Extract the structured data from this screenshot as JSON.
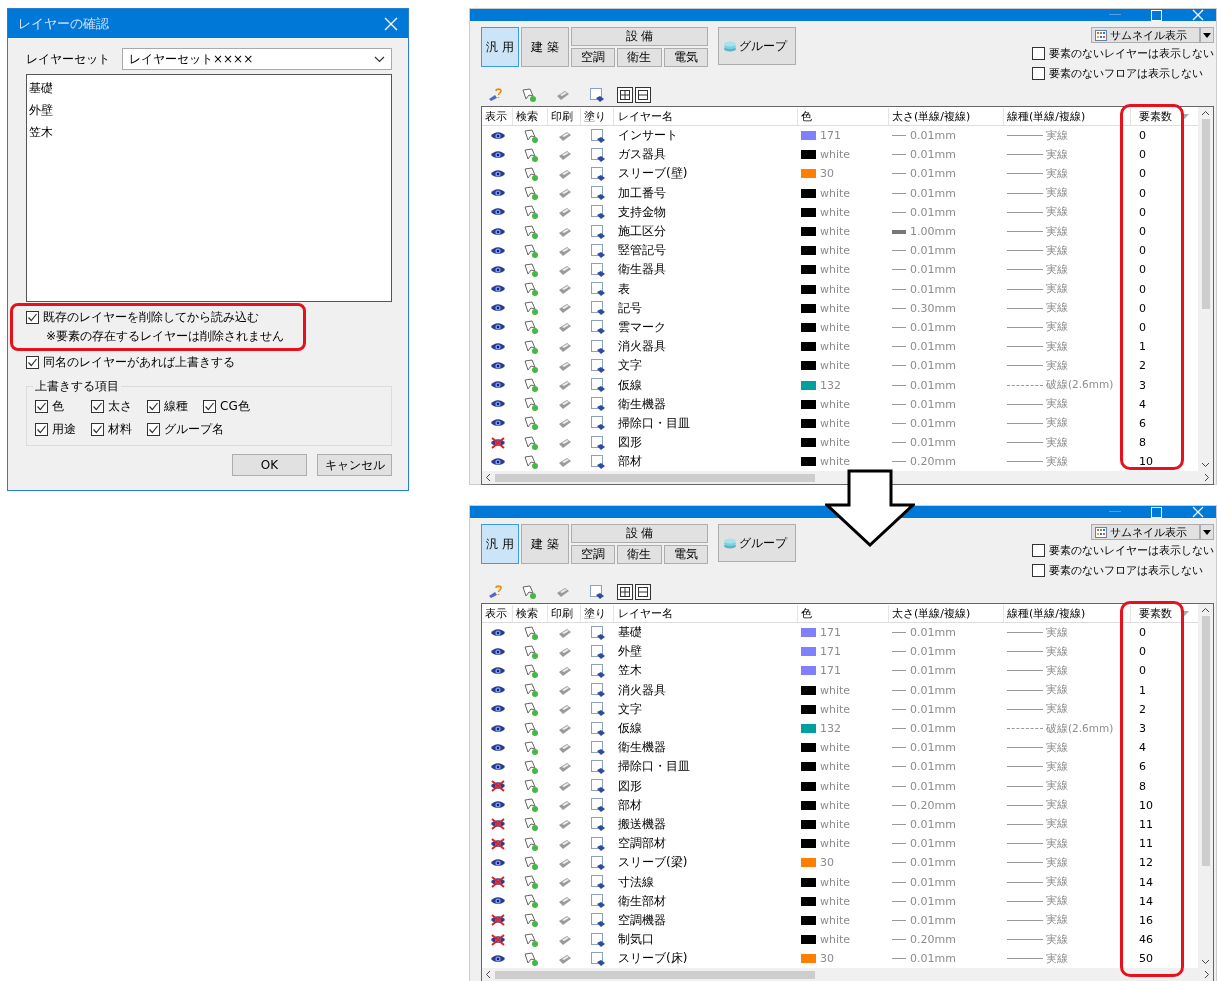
{
  "dialog": {
    "title": "レイヤーの確認",
    "layer_set": {
      "label": "レイヤーセット",
      "value": "レイヤーセット××××"
    },
    "layers": [
      "基礎",
      "外壁",
      "笠木"
    ],
    "options": [
      {
        "label": "既存のレイヤーを削除してから読み込む",
        "note": "※要素の存在するレイヤーは削除されません",
        "checked": true,
        "highlighted": true
      },
      {
        "label": "同名のレイヤーがあれば上書きする",
        "checked": true,
        "highlighted": false
      }
    ],
    "override_group": {
      "title": "上書きする項目",
      "items": [
        {
          "label": "色",
          "checked": true
        },
        {
          "label": "太さ",
          "checked": true
        },
        {
          "label": "線種",
          "checked": true
        },
        {
          "label": "CG色",
          "checked": true
        },
        {
          "label": "用途",
          "checked": true
        },
        {
          "label": "材料",
          "checked": true
        },
        {
          "label": "グループ名",
          "checked": true
        }
      ]
    },
    "buttons": [
      "OK",
      "キャンセル"
    ]
  },
  "windows": [
    {
      "tabs": [
        {
          "label": "汎 用",
          "selected": true
        },
        {
          "label": "建 築",
          "selected": false
        }
      ],
      "equipment": {
        "label": "設 備",
        "tabs": [
          {
            "label": "空調",
            "selected": false
          },
          {
            "label": "衛生",
            "selected": false
          },
          {
            "label": "電気",
            "selected": false
          }
        ]
      },
      "group_button": "グループ",
      "view_select": "サムネイル表示",
      "filters": [
        {
          "label": "要素のないレイヤーは表示しない",
          "checked": false
        },
        {
          "label": "要素のないフロアは表示しない",
          "checked": false
        }
      ],
      "columns": [
        "表示",
        "検索",
        "印刷",
        "塗り",
        "レイヤー名",
        "色",
        "太さ(単線/複線)",
        "線種(単線/複線)",
        "要素数"
      ],
      "highlight_count_column": true,
      "rows": [
        {
          "visible": true,
          "name": "インサート",
          "color": "#8080ff",
          "color_label": "171",
          "thickness": "0.01mm",
          "heavy": false,
          "linetype": "実線",
          "dashed": false,
          "count": "0"
        },
        {
          "visible": true,
          "name": "ガス器具",
          "color": "#000000",
          "color_label": "white",
          "thickness": "0.01mm",
          "heavy": false,
          "linetype": "実線",
          "dashed": false,
          "count": "0"
        },
        {
          "visible": true,
          "name": "スリーブ(壁)",
          "color": "#ff8000",
          "color_label": "30",
          "thickness": "0.01mm",
          "heavy": false,
          "linetype": "実線",
          "dashed": false,
          "count": "0"
        },
        {
          "visible": true,
          "name": "加工番号",
          "color": "#000000",
          "color_label": "white",
          "thickness": "0.01mm",
          "heavy": false,
          "linetype": "実線",
          "dashed": false,
          "count": "0"
        },
        {
          "visible": true,
          "name": "支持金物",
          "color": "#000000",
          "color_label": "white",
          "thickness": "0.01mm",
          "heavy": false,
          "linetype": "実線",
          "dashed": false,
          "count": "0"
        },
        {
          "visible": true,
          "name": "施工区分",
          "color": "#000000",
          "color_label": "white",
          "thickness": "1.00mm",
          "heavy": true,
          "linetype": "実線",
          "dashed": false,
          "count": "0"
        },
        {
          "visible": true,
          "name": "竪管記号",
          "color": "#000000",
          "color_label": "white",
          "thickness": "0.01mm",
          "heavy": false,
          "linetype": "実線",
          "dashed": false,
          "count": "0"
        },
        {
          "visible": true,
          "name": "衛生器具",
          "color": "#000000",
          "color_label": "white",
          "thickness": "0.01mm",
          "heavy": false,
          "linetype": "実線",
          "dashed": false,
          "count": "0"
        },
        {
          "visible": true,
          "name": "表",
          "color": "#000000",
          "color_label": "white",
          "thickness": "0.01mm",
          "heavy": false,
          "linetype": "実線",
          "dashed": false,
          "count": "0"
        },
        {
          "visible": true,
          "name": "記号",
          "color": "#000000",
          "color_label": "white",
          "thickness": "0.30mm",
          "heavy": false,
          "linetype": "実線",
          "dashed": false,
          "count": "0"
        },
        {
          "visible": true,
          "name": "雲マーク",
          "color": "#000000",
          "color_label": "white",
          "thickness": "0.01mm",
          "heavy": false,
          "linetype": "実線",
          "dashed": false,
          "count": "0"
        },
        {
          "visible": true,
          "name": "消火器具",
          "color": "#000000",
          "color_label": "white",
          "thickness": "0.01mm",
          "heavy": false,
          "linetype": "実線",
          "dashed": false,
          "count": "1"
        },
        {
          "visible": true,
          "name": "文字",
          "color": "#000000",
          "color_label": "white",
          "thickness": "0.01mm",
          "heavy": false,
          "linetype": "実線",
          "dashed": false,
          "count": "2"
        },
        {
          "visible": true,
          "name": "仮線",
          "color": "#00a0a0",
          "color_label": "132",
          "thickness": "0.01mm",
          "heavy": false,
          "linetype": "破線(2.6mm)",
          "dashed": true,
          "count": "3"
        },
        {
          "visible": true,
          "name": "衛生機器",
          "color": "#000000",
          "color_label": "white",
          "thickness": "0.01mm",
          "heavy": false,
          "linetype": "実線",
          "dashed": false,
          "count": "4"
        },
        {
          "visible": true,
          "name": "掃除口・目皿",
          "color": "#000000",
          "color_label": "white",
          "thickness": "0.01mm",
          "heavy": false,
          "linetype": "実線",
          "dashed": false,
          "count": "6"
        },
        {
          "visible": false,
          "name": "図形",
          "color": "#000000",
          "color_label": "white",
          "thickness": "0.01mm",
          "heavy": false,
          "linetype": "実線",
          "dashed": false,
          "count": "8"
        },
        {
          "visible": true,
          "name": "部材",
          "color": "#000000",
          "color_label": "white",
          "thickness": "0.20mm",
          "heavy": false,
          "linetype": "実線",
          "dashed": false,
          "count": "10"
        }
      ]
    },
    {
      "tabs": [
        {
          "label": "汎 用",
          "selected": true
        },
        {
          "label": "建 築",
          "selected": false
        }
      ],
      "equipment": {
        "label": "設 備",
        "tabs": [
          {
            "label": "空調",
            "selected": false
          },
          {
            "label": "衛生",
            "selected": false
          },
          {
            "label": "電気",
            "selected": false
          }
        ]
      },
      "group_button": "グループ",
      "view_select": "サムネイル表示",
      "filters": [
        {
          "label": "要素のないレイヤーは表示しない",
          "checked": false
        },
        {
          "label": "要素のないフロアは表示しない",
          "checked": false
        }
      ],
      "columns": [
        "表示",
        "検索",
        "印刷",
        "塗り",
        "レイヤー名",
        "色",
        "太さ(単線/複線)",
        "線種(単線/複線)",
        "要素数"
      ],
      "highlight_count_column": true,
      "rows": [
        {
          "visible": true,
          "name": "基礎",
          "color": "#8080ff",
          "color_label": "171",
          "thickness": "0.01mm",
          "heavy": false,
          "linetype": "実線",
          "dashed": false,
          "count": "0"
        },
        {
          "visible": true,
          "name": "外壁",
          "color": "#8080ff",
          "color_label": "171",
          "thickness": "0.01mm",
          "heavy": false,
          "linetype": "実線",
          "dashed": false,
          "count": "0"
        },
        {
          "visible": true,
          "name": "笠木",
          "color": "#8080ff",
          "color_label": "171",
          "thickness": "0.01mm",
          "heavy": false,
          "linetype": "実線",
          "dashed": false,
          "count": "0"
        },
        {
          "visible": true,
          "name": "消火器具",
          "color": "#000000",
          "color_label": "white",
          "thickness": "0.01mm",
          "heavy": false,
          "linetype": "実線",
          "dashed": false,
          "count": "1"
        },
        {
          "visible": true,
          "name": "文字",
          "color": "#000000",
          "color_label": "white",
          "thickness": "0.01mm",
          "heavy": false,
          "linetype": "実線",
          "dashed": false,
          "count": "2"
        },
        {
          "visible": true,
          "name": "仮線",
          "color": "#00a0a0",
          "color_label": "132",
          "thickness": "0.01mm",
          "heavy": false,
          "linetype": "破線(2.6mm)",
          "dashed": true,
          "count": "3"
        },
        {
          "visible": true,
          "name": "衛生機器",
          "color": "#000000",
          "color_label": "white",
          "thickness": "0.01mm",
          "heavy": false,
          "linetype": "実線",
          "dashed": false,
          "count": "4"
        },
        {
          "visible": true,
          "name": "掃除口・目皿",
          "color": "#000000",
          "color_label": "white",
          "thickness": "0.01mm",
          "heavy": false,
          "linetype": "実線",
          "dashed": false,
          "count": "6"
        },
        {
          "visible": false,
          "name": "図形",
          "color": "#000000",
          "color_label": "white",
          "thickness": "0.01mm",
          "heavy": false,
          "linetype": "実線",
          "dashed": false,
          "count": "8"
        },
        {
          "visible": true,
          "name": "部材",
          "color": "#000000",
          "color_label": "white",
          "thickness": "0.20mm",
          "heavy": false,
          "linetype": "実線",
          "dashed": false,
          "count": "10"
        },
        {
          "visible": false,
          "name": "搬送機器",
          "color": "#000000",
          "color_label": "white",
          "thickness": "0.01mm",
          "heavy": false,
          "linetype": "実線",
          "dashed": false,
          "count": "11"
        },
        {
          "visible": false,
          "name": "空調部材",
          "color": "#000000",
          "color_label": "white",
          "thickness": "0.01mm",
          "heavy": false,
          "linetype": "実線",
          "dashed": false,
          "count": "11"
        },
        {
          "visible": true,
          "name": "スリーブ(梁)",
          "color": "#ff8000",
          "color_label": "30",
          "thickness": "0.01mm",
          "heavy": false,
          "linetype": "実線",
          "dashed": false,
          "count": "12"
        },
        {
          "visible": false,
          "name": "寸法線",
          "color": "#000000",
          "color_label": "white",
          "thickness": "0.01mm",
          "heavy": false,
          "linetype": "実線",
          "dashed": false,
          "count": "14"
        },
        {
          "visible": true,
          "name": "衛生部材",
          "color": "#000000",
          "color_label": "white",
          "thickness": "0.01mm",
          "heavy": false,
          "linetype": "実線",
          "dashed": false,
          "count": "14"
        },
        {
          "visible": false,
          "name": "空調機器",
          "color": "#000000",
          "color_label": "white",
          "thickness": "0.01mm",
          "heavy": false,
          "linetype": "実線",
          "dashed": false,
          "count": "16"
        },
        {
          "visible": false,
          "name": "制気口",
          "color": "#000000",
          "color_label": "white",
          "thickness": "0.20mm",
          "heavy": false,
          "linetype": "実線",
          "dashed": false,
          "count": "46"
        },
        {
          "visible": true,
          "name": "スリーブ(床)",
          "color": "#ff8000",
          "color_label": "30",
          "thickness": "0.01mm",
          "heavy": false,
          "linetype": "実線",
          "dashed": false,
          "count": "50"
        }
      ]
    }
  ]
}
